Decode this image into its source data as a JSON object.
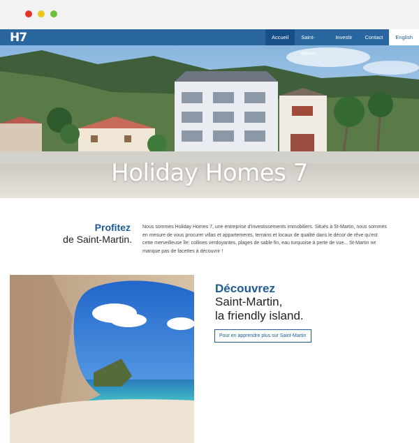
{
  "browser": {
    "controls": [
      "close",
      "minimize",
      "maximize"
    ]
  },
  "header": {
    "logo": "H7",
    "nav": [
      {
        "label": "Accueil",
        "active": true
      },
      {
        "label": "Saint-Martin",
        "active": false
      },
      {
        "label": "Investir",
        "active": false
      },
      {
        "label": "Contact",
        "active": false
      },
      {
        "label": "English",
        "active": false
      }
    ]
  },
  "hero": {
    "title": "Holiday Homes 7"
  },
  "intro": {
    "heading_strong": "Profitez",
    "heading_rest": "de Saint-Martin.",
    "text": "Nous sommes Holiday Homes 7, une entreprise d'investissements immobiliers. Situés à St-Martin, nous sommes en mesure de vous procurer villas et appartements, terrains et locaux de qualité dans le décor de rêve qu'est cette merveilleuse île: collines verdoyantes, plages de sable fin, eau turquoise à perte de vue... St-Martin ne manque pas de facettes à découvrir !"
  },
  "discover": {
    "heading_strong": "Découvrez",
    "line1": "Saint-Martin,",
    "line2": "la friendly island.",
    "button": "Pour en apprendre plus sur Saint-Martin"
  },
  "colors": {
    "brand": "#1d5a96",
    "nav_active": "#175087",
    "mac_red": "#e2332b",
    "mac_yellow": "#ebc81a",
    "mac_green": "#67c23a"
  }
}
